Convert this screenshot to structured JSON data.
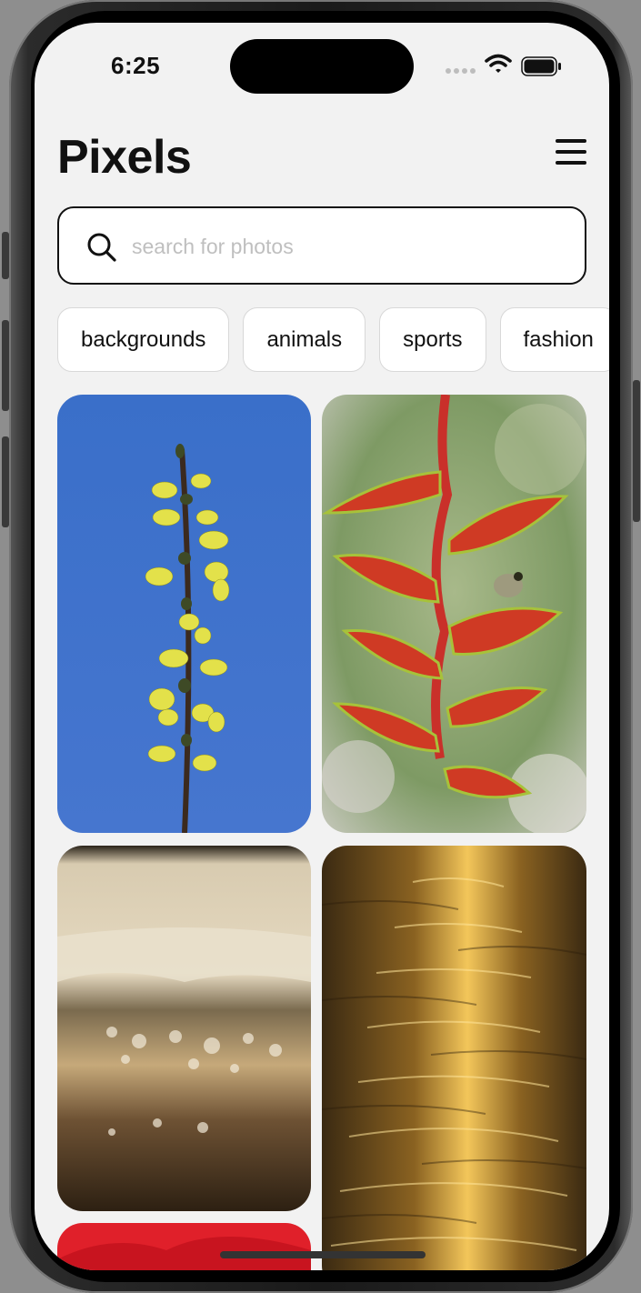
{
  "status_bar": {
    "time": "6:25"
  },
  "header": {
    "title": "Pixels",
    "menu_icon": "hamburger-menu-icon"
  },
  "search": {
    "placeholder": "search for photos",
    "value": "",
    "icon": "search-icon"
  },
  "categories": [
    {
      "label": "backgrounds"
    },
    {
      "label": "animals"
    },
    {
      "label": "sports"
    },
    {
      "label": "fashion"
    }
  ],
  "photos": [
    {
      "subject": "yellow-flower-branch"
    },
    {
      "subject": "heliconia-with-frog"
    },
    {
      "subject": "fermenting-jar"
    },
    {
      "subject": "sunlit-water"
    },
    {
      "subject": "red-petals"
    }
  ],
  "colors": {
    "background": "#f2f2f2",
    "text": "#111111",
    "placeholder": "#bfbfbf"
  }
}
